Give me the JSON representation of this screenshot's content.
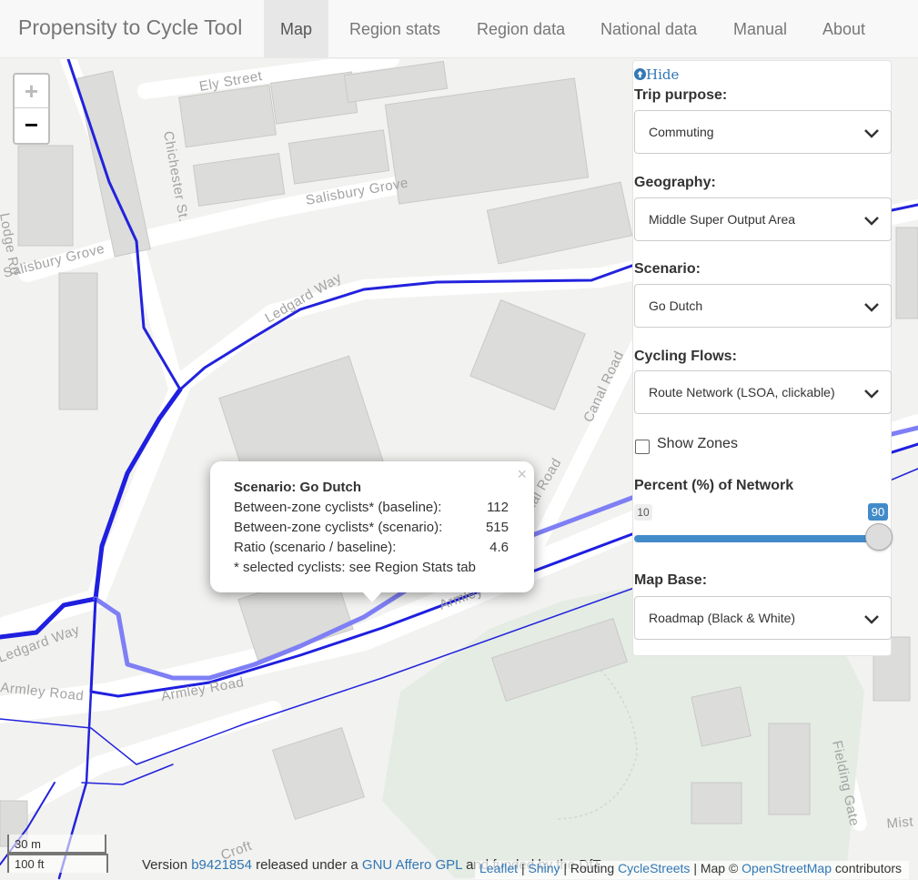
{
  "navbar": {
    "brand": "Propensity to Cycle Tool",
    "tabs": [
      {
        "label": "Map",
        "active": true
      },
      {
        "label": "Region stats"
      },
      {
        "label": "Region data"
      },
      {
        "label": "National data"
      },
      {
        "label": "Manual"
      },
      {
        "label": "About"
      }
    ]
  },
  "map": {
    "zoom_in": "+",
    "zoom_out": "−",
    "street_labels": [
      "Ely Street",
      "Chichester St.",
      "Salisbury Grove",
      "Salisbury Grove",
      "Ledgard Way",
      "Ledgard Way",
      "Canal Road",
      "Canal Road",
      "Armley Road",
      "Armley Road",
      "Armley Road",
      "Lodge Rd",
      "Fielding Gate",
      "Croft",
      "Mist"
    ],
    "route_colors": {
      "primary": "#1f1fe0",
      "light": "#7f7ff5"
    }
  },
  "popup": {
    "close": "×",
    "title": "Scenario: Go Dutch",
    "rows": [
      {
        "label": "Between-zone cyclists* (baseline):",
        "value": "112"
      },
      {
        "label": "Between-zone cyclists* (scenario):",
        "value": "515"
      },
      {
        "label": "Ratio (scenario / baseline):",
        "value": "4.6"
      }
    ],
    "note": "* selected cyclists: see Region Stats tab"
  },
  "panel": {
    "hide": "Hide",
    "trip_purpose": {
      "label": "Trip purpose:",
      "value": "Commuting"
    },
    "geography": {
      "label": "Geography:",
      "value": "Middle Super Output Area"
    },
    "scenario": {
      "label": "Scenario:",
      "value": "Go Dutch"
    },
    "cycling_flows": {
      "label": "Cycling Flows:",
      "value": "Route Network (LSOA, clickable)"
    },
    "show_zones": "Show Zones",
    "percent_network": {
      "label": "Percent (%) of Network",
      "min": "10",
      "max": "90",
      "level": 0.9
    },
    "map_base": {
      "label": "Map Base:",
      "value": "Roadmap (Black & White)"
    }
  },
  "scale": {
    "metric": "30 m",
    "imperial": "100 ft"
  },
  "footer": {
    "version_prefix": "Version",
    "version_link": "b9421854",
    "released": "released under a",
    "license_link": "GNU Affero GPL",
    "funded": "and funded by the DfT"
  },
  "attribution": {
    "leaflet": "Leaflet",
    "sep1": "|",
    "shiny": "Shiny",
    "routing": "| Routing",
    "cyclestreets": "CycleStreets",
    "map": "| Map ©",
    "osm": "OpenStreetMap",
    "contributors": "contributors"
  }
}
